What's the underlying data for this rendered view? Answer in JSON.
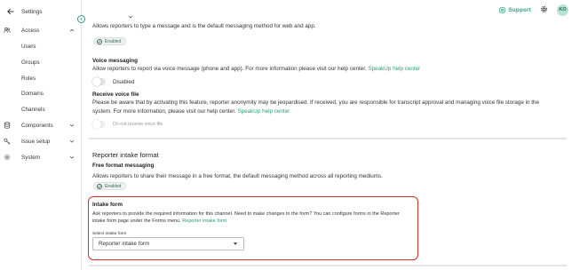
{
  "sidebar": {
    "back_label": "Settings",
    "groups": [
      {
        "label": "Access",
        "icon": "users-icon",
        "expanded": true
      },
      {
        "label": "Components",
        "icon": "database-icon",
        "expanded": false
      },
      {
        "label": "Issue setup",
        "icon": "key-icon",
        "expanded": false
      },
      {
        "label": "System",
        "icon": "gear-icon",
        "expanded": false
      }
    ],
    "access_items": [
      "Users",
      "Groups",
      "Roles",
      "Domains",
      "Channels"
    ]
  },
  "header": {
    "support_label": "Support",
    "avatar_initials": "KO"
  },
  "main": {
    "top_desc": "Allows reporters to type a message and is the default messaging method for web and app.",
    "top_badge": "Enabled",
    "voice": {
      "title": "Voice messaging",
      "desc": "Allow reporters to report via voice message (phone and app). For more information please visit our help center.",
      "link": "SpeakUp help center",
      "toggle_label": "Disabled"
    },
    "voice_file": {
      "title": "Receive voice file",
      "desc_line1": "Please be aware that by activating this feature, reporter anonymity may be jeopardised. If received, you are responsible for transcript approval and managing voice file storage in the",
      "desc_line2": "system. For more information, please visit our help center.",
      "link": "SpeakUp help center",
      "toggle_label": "Do not receive voice file"
    },
    "intake_section": {
      "title": "Reporter intake format",
      "free_title": "Free format messaging",
      "free_desc": "Allows reporters to share their message in a free format, the default messaging method across all reporting mediums.",
      "free_badge": "Enabled"
    },
    "intake_form": {
      "title": "Intake form",
      "desc_line1": "Ask reporters to provide the required information for this channel. Need to make changes to the form? You can configure forms in the Reporter",
      "desc_line2": "intake form page under the Forms menu.",
      "link": "Reporter intake form",
      "select_label": "Select intake form",
      "select_value": "Reporter intake form"
    }
  },
  "colors": {
    "accent": "#2a9d7a",
    "highlight_border": "#d93025"
  }
}
